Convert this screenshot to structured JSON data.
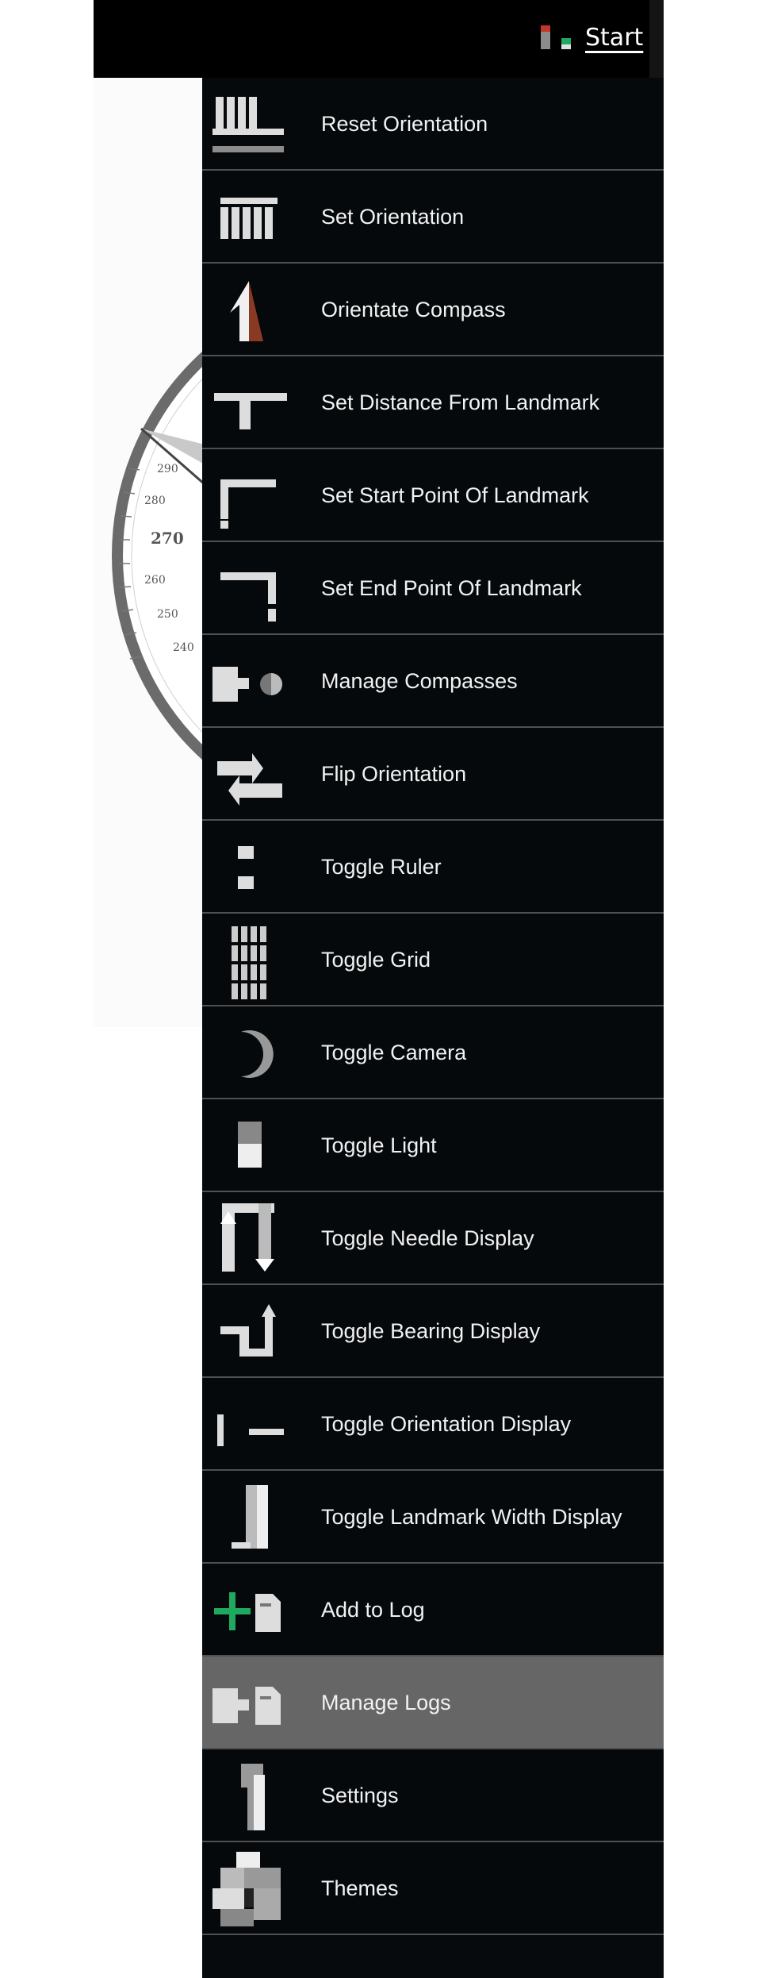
{
  "header": {
    "start_label": "Start"
  },
  "compass": {
    "ticks": [
      "290",
      "280",
      "270",
      "260",
      "250",
      "240"
    ]
  },
  "menu": {
    "items": [
      {
        "label": "Reset Orientation"
      },
      {
        "label": "Set Orientation"
      },
      {
        "label": "Orientate Compass"
      },
      {
        "label": "Set Distance From Landmark"
      },
      {
        "label": "Set Start Point Of Landmark"
      },
      {
        "label": "Set End Point Of Landmark"
      },
      {
        "label": "Manage Compasses"
      },
      {
        "label": "Flip Orientation"
      },
      {
        "label": "Toggle Ruler"
      },
      {
        "label": "Toggle Grid"
      },
      {
        "label": "Toggle Camera"
      },
      {
        "label": "Toggle Light"
      },
      {
        "label": "Toggle Needle Display"
      },
      {
        "label": "Toggle Bearing Display"
      },
      {
        "label": "Toggle Orientation Display"
      },
      {
        "label": "Toggle Landmark Width Display"
      },
      {
        "label": "Add to Log"
      },
      {
        "label": "Manage Logs"
      },
      {
        "label": "Settings"
      },
      {
        "label": "Themes"
      }
    ],
    "active_item": "Manage Logs"
  },
  "colors": {
    "menu_bg": "#070a0d",
    "active_bg": "#666666",
    "accent_green": "#1fa860",
    "accent_red": "#c0392b",
    "compass_arrow_brown": "#8a3a22"
  }
}
